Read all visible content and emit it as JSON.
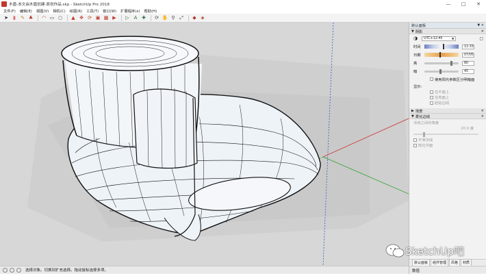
{
  "window": {
    "title": "木盾-本文由木盾创建-原创作品.skp - SketchUp Pro 2018",
    "controls": [
      "minimize-icon",
      "maximize-icon",
      "close-icon"
    ]
  },
  "menu": [
    "文件(F)",
    "编辑(E)",
    "视图(V)",
    "相机(C)",
    "绘图(R)",
    "工具(T)",
    "窗口(W)",
    "扩展程序(x)",
    "帮助(H)"
  ],
  "toolbar_icons": [
    "select-icon",
    "eraser-icon",
    "pencil-icon",
    "paint-icon",
    "arc-icon",
    "rectangle-icon",
    "circle-icon",
    "push-pull-icon",
    "move-icon",
    "rotate-icon",
    "scale-icon",
    "offset-icon",
    "follow-me-icon",
    "tape-icon",
    "text-icon",
    "axes-icon",
    "orbit-icon",
    "pan-icon",
    "zoom-icon",
    "zoom-extents-icon",
    "components-icon",
    "section-icon"
  ],
  "tray": {
    "title": "默认面板",
    "shadows": {
      "header": "阴影",
      "utc": "UTC+12:45",
      "time_label": "时间",
      "time_value": "11:33",
      "date_label": "日期",
      "date_value": "07/05",
      "light_label": "亮",
      "light_value": "80",
      "dark_label": "暗",
      "dark_value": "45",
      "sun_for_shading": "使用阳光参数区分明暗面",
      "display_label": "显示:",
      "on_faces": "在平面上",
      "on_ground": "在地面上",
      "from_edges": "起始边线"
    },
    "scenes_header": "场景",
    "soften": {
      "header": "柔化边线",
      "normal_angle": "法线之间的角度",
      "angle_value": "20.0 度",
      "smooth_normals": "平滑法线",
      "soften_coplanar": "软化共面"
    },
    "tabs": [
      "默认面板",
      "组件管理",
      "风格",
      "材质"
    ]
  },
  "status": {
    "message": "选择对象。切换到扩充选择。拖动鼠标选择多项。",
    "measure_label": "数值"
  },
  "watermark": "SketchUp吧",
  "colors": {
    "viewport_bg": "#d7d7d7",
    "ground_plane": "#cfcfcf",
    "axis_red": "#cc3333",
    "axis_green": "#2fa22f",
    "axis_blue": "#3355cc",
    "model_edges": "#111111",
    "model_fill": "#eef3f8"
  }
}
